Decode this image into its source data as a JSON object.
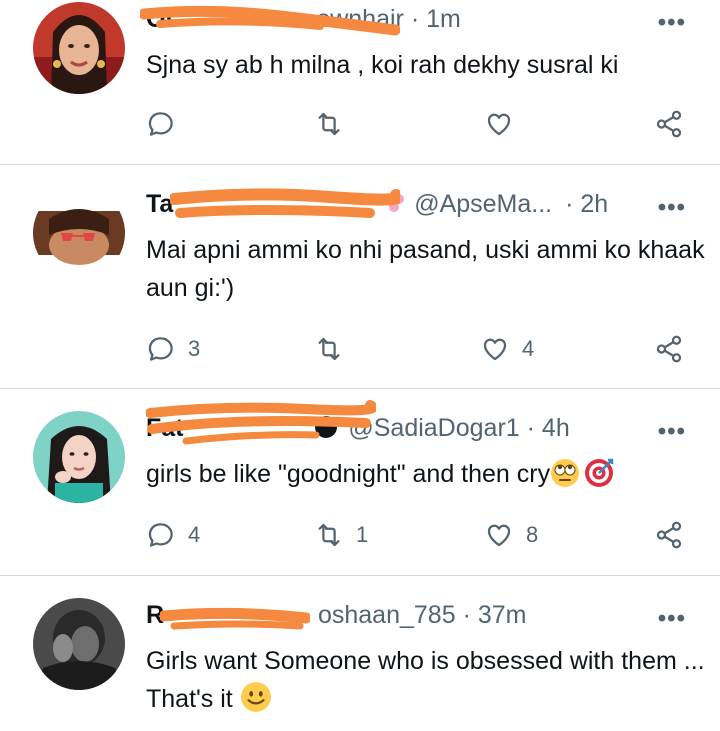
{
  "tweets": [
    {
      "name": "Ol",
      "handle": "ownhair",
      "time": "· 1m",
      "text": "Sjna sy ab h milna , koi rah dekhy susral ki",
      "replies": "",
      "retweets": "",
      "likes": ""
    },
    {
      "name": "Ta",
      "handle": "@ApseMa...",
      "time": "· 2h",
      "text": "Mai apni ammi ko nhi pasand, uski ammi ko khaak aun gi:')",
      "replies": "3",
      "retweets": "",
      "likes": "4"
    },
    {
      "name": "Fat",
      "handle": "@SadiaDogar1",
      "time": "· 4h",
      "text": "girls be like \"goodnight\" and then cry",
      "replies": "4",
      "retweets": "1",
      "likes": "8"
    },
    {
      "name": "R",
      "handle": "oshaan_785",
      "time": "· 37m",
      "text": "Girls want Someone who is obsessed with them ... That's it",
      "replies": "",
      "retweets": "",
      "likes": ""
    }
  ],
  "more_label": "•••",
  "emoji": [
    "rolling-eyes-emoji",
    "bullseye-emoji",
    "smiling-emoji",
    "cherry-blossom-emoji"
  ],
  "colors": {
    "scribble": "#f5893f",
    "muted": "#536471",
    "divider": "#cfd9de"
  }
}
